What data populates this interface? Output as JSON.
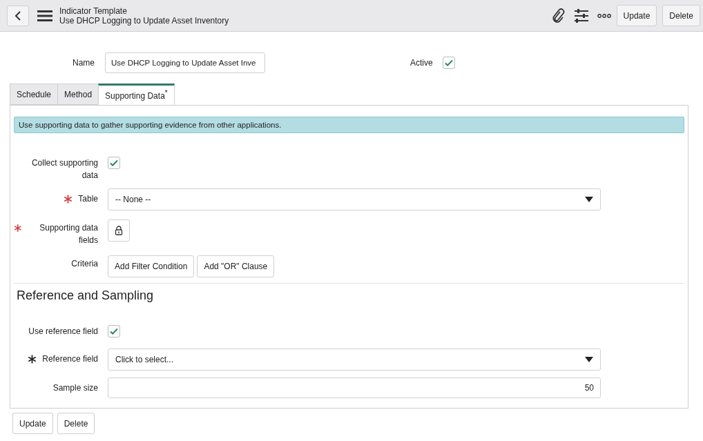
{
  "header": {
    "title": "Indicator Template",
    "subtitle": "Use DHCP Logging to Update Asset Inventory",
    "buttons": [
      "Update",
      "Delete"
    ]
  },
  "name_row": {
    "label": "Name",
    "value": "Use DHCP Logging to Update Asset Inve",
    "active_label": "Active",
    "active_checked": true
  },
  "tabs": [
    {
      "label": "Schedule",
      "selected": false
    },
    {
      "label": "Method",
      "selected": false
    },
    {
      "label": "Supporting Data$^{*}$",
      "selected": true
    }
  ],
  "info": "Use supporting data to gather supporting evidence from other applications.",
  "fields": [
    {
      "kind": "checkbox",
      "label": "Collect supporting data",
      "checked": true
    },
    {
      "kind": "select",
      "label": "Table",
      "mandatory": true,
      "mandatory_met": false,
      "value": "-- None --"
    },
    {
      "kind": "lock",
      "label": "Supporting data fields",
      "mandatory": true,
      "mandatory_met": false
    },
    {
      "kind": "buttons",
      "label": "Criteria",
      "buttons": [
        "Add Filter Condition",
        "Add \"OR\" Clause"
      ]
    }
  ],
  "section_title": "Reference and Sampling",
  "section_fields": [
    {
      "kind": "checkbox",
      "label": "Use reference field",
      "checked": true
    },
    {
      "kind": "select",
      "label": "Reference field",
      "mandatory": true,
      "mandatory_met": true,
      "value": "Click to select..."
    },
    {
      "kind": "number",
      "label": "Sample size",
      "value": "50"
    }
  ],
  "footer_buttons": [
    "Update",
    "Delete"
  ]
}
